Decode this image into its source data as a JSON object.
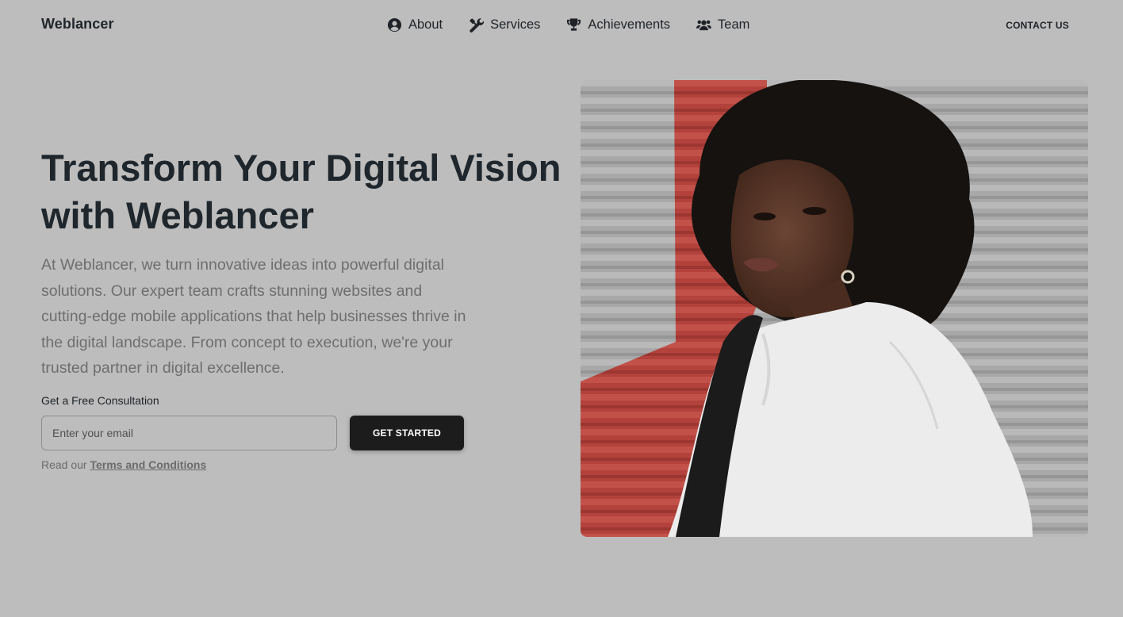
{
  "header": {
    "brand": "Weblancer",
    "nav": [
      {
        "label": "About",
        "icon": "user-circle-icon"
      },
      {
        "label": "Services",
        "icon": "tools-icon"
      },
      {
        "label": "Achievements",
        "icon": "trophy-icon"
      },
      {
        "label": "Team",
        "icon": "users-icon"
      }
    ],
    "contact_label": "CONTACT US"
  },
  "hero": {
    "title": "Transform Your Digital Vision with Weblancer",
    "description": "At Weblancer, we turn innovative ideas into powerful digital solutions. Our expert team crafts stunning websites and cutting-edge mobile applications that help businesses thrive in the digital landscape. From concept to execution, we're your trusted partner in digital excellence.",
    "form": {
      "label": "Get a Free Consultation",
      "email_placeholder": "Enter your email",
      "email_value": "",
      "button_label": "GET STARTED"
    },
    "terms_prefix": "Read our",
    "terms_link": "Terms and Conditions",
    "image": {
      "subject": "portrait-photo",
      "colors": {
        "background_gray": "#a9a9a9",
        "accent_red": "#b8463f",
        "hair": "#151210",
        "jacket": "#ededed"
      }
    }
  },
  "colors": {
    "page_background": "#bdbdbd",
    "text_primary": "#1f272d",
    "text_muted": "#6e6e6e",
    "button_background": "#1c1c1c",
    "button_text": "#ffffff"
  }
}
